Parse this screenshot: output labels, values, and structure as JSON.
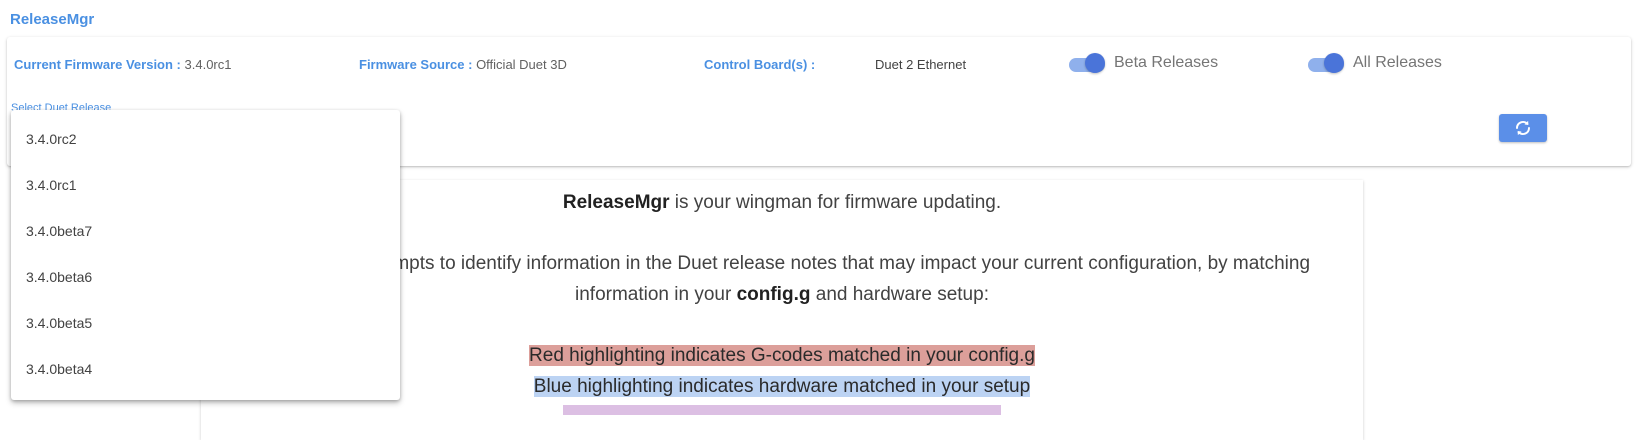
{
  "app": {
    "title": "ReleaseMgr"
  },
  "info": {
    "firmware_label": "Current Firmware Version :",
    "firmware_value": "3.4.0rc1",
    "source_label": "Firmware Source :",
    "source_value": "Official Duet 3D",
    "board_label": "Control Board(s) :",
    "board_value": "Duet 2 Ethernet"
  },
  "switches": {
    "beta_label": "Beta Releases",
    "beta_on": true,
    "all_label": "All Releases",
    "all_on": true
  },
  "select": {
    "label": "Select Duet Release",
    "options": [
      "3.4.0rc2",
      "3.4.0rc1",
      "3.4.0beta7",
      "3.4.0beta6",
      "3.4.0beta5",
      "3.4.0beta4"
    ]
  },
  "refresh": {
    "icon": "refresh-icon"
  },
  "content": {
    "intro_bold": "ReleaseMgr",
    "intro_rest": " is your wingman for firmware updating.",
    "para_1": "ReleaseMgr attempts to identify information in the Duet release notes that may impact your current configuration, by matching",
    "para_2_pre": "information in your ",
    "para_2_bold": "config.g",
    "para_2_post": " and hardware setup:",
    "red_note": "Red highlighting indicates G-codes matched in your config.g",
    "blue_note": "Blue highlighting indicates hardware matched in your setup"
  },
  "colors": {
    "accent": "#4a90e2",
    "button": "#5b8fe8",
    "red_highlight": "#dc9f9a",
    "blue_highlight": "#bcd3f3",
    "purple_highlight": "#dcbfe3"
  }
}
